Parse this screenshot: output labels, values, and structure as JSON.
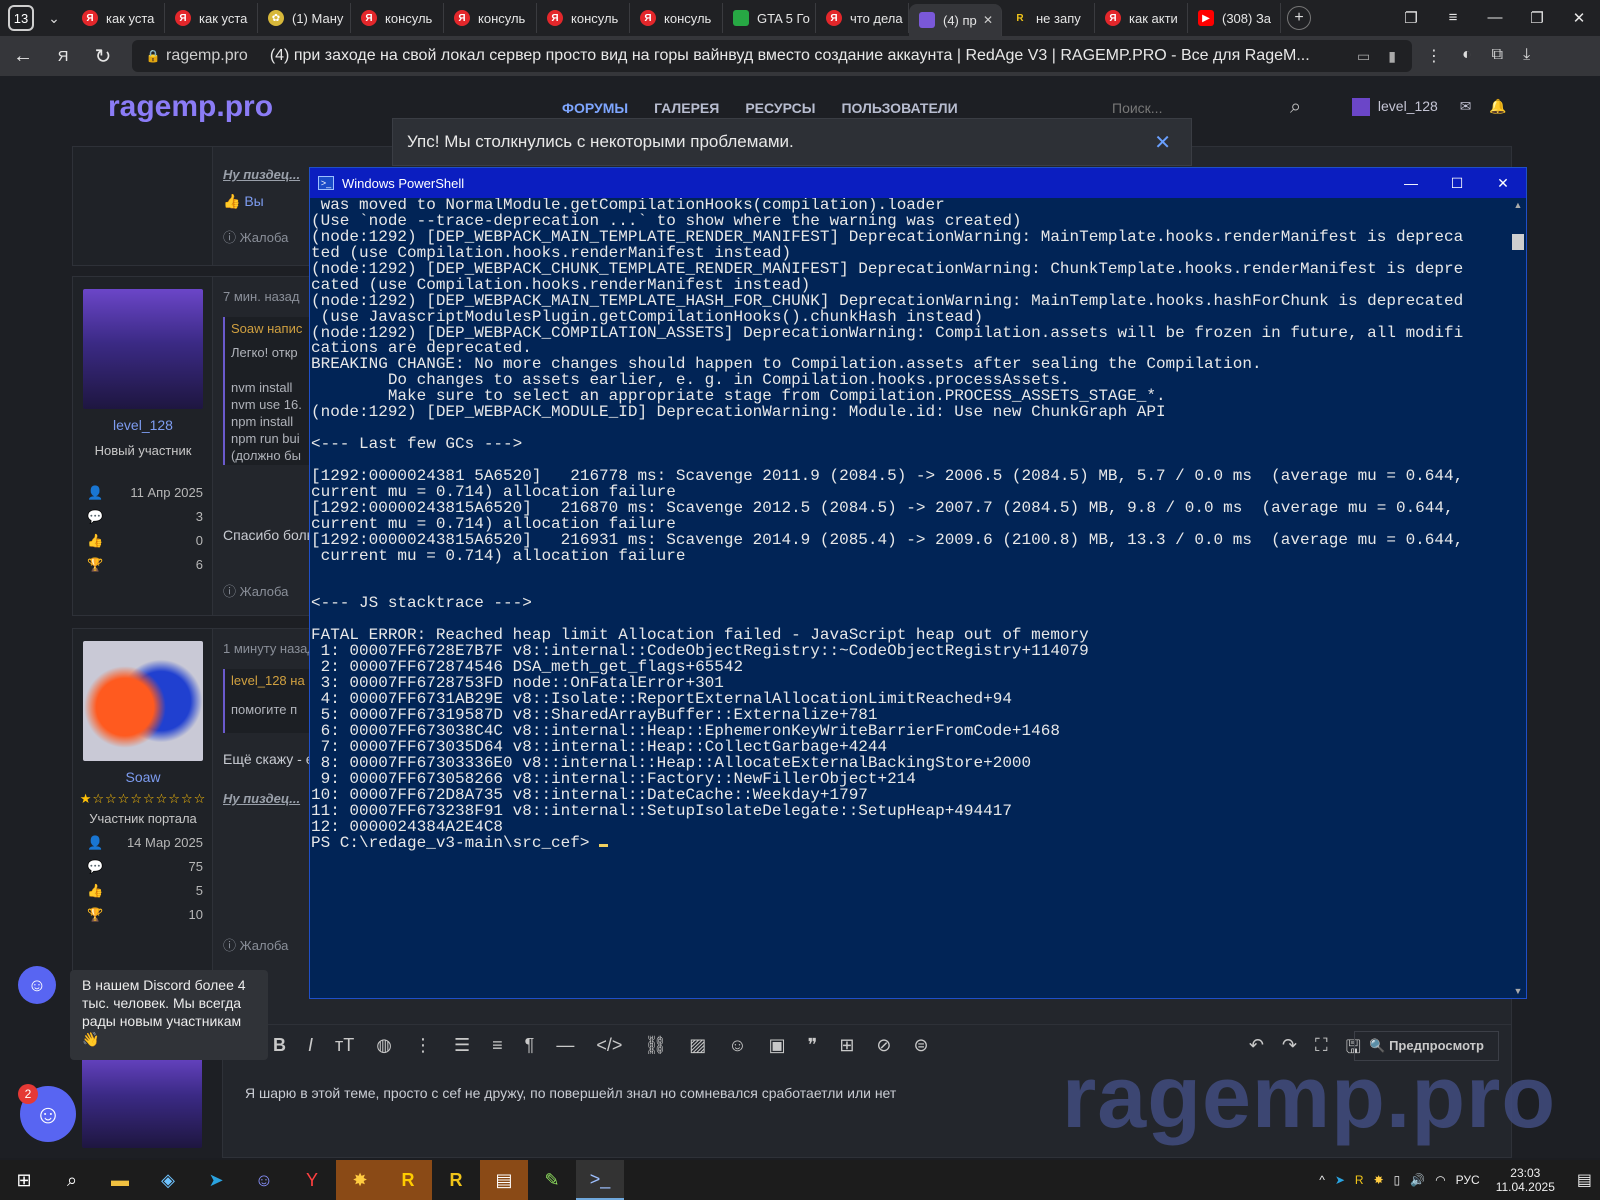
{
  "browser": {
    "tab_count": "13",
    "tabs": [
      {
        "label": "как уста",
        "icon": "ya"
      },
      {
        "label": "как уста",
        "icon": "ya"
      },
      {
        "label": "(1) Ману",
        "icon": "flower"
      },
      {
        "label": "консуль",
        "icon": "ya"
      },
      {
        "label": "консуль",
        "icon": "ya"
      },
      {
        "label": "консуль",
        "icon": "ya"
      },
      {
        "label": "консуль",
        "icon": "ya"
      },
      {
        "label": "GTA 5 Го",
        "icon": "green"
      },
      {
        "label": "что дела",
        "icon": "ya"
      },
      {
        "label": "(4) пр",
        "icon": "rage",
        "active": true
      },
      {
        "label": "не запу",
        "icon": "r"
      },
      {
        "label": "как акти",
        "icon": "ya"
      },
      {
        "label": "(308) За",
        "icon": "yt"
      }
    ],
    "address_domain": "ragemp.pro",
    "address_title": "(4) при заходе на свой локал сервер просто вид на горы вайнвуд вместо создание аккаунта | RedAge V3 | RAGEMP.PRO - Все для RageM..."
  },
  "site": {
    "logo": "ragemp.pro",
    "nav": [
      "ФОРУМЫ",
      "ГАЛЕРЕЯ",
      "РЕСУРСЫ",
      "ПОЛЬЗОВАТЕЛИ"
    ],
    "search_placeholder": "Поиск...",
    "user": "level_128",
    "error_banner": "Упс! Мы столкнулись с некоторыми проблемами.",
    "post0": {
      "sig": "Ну пиздец...",
      "you": "Вы",
      "report": "Жалоба"
    },
    "post1": {
      "time": "7 мин. назад",
      "username": "level_128",
      "role": "Новый участник",
      "joined": "11 Апр 2025",
      "messages": "3",
      "reactions": "0",
      "points": "6",
      "quote_author": "Soaw напис",
      "text_lines": [
        "Легко! откр",
        "nvm install",
        "nvm use 16.",
        "npm install",
        "npm run bui",
        "(должно бы"
      ],
      "reply": "Спасибо боль",
      "report": "Жалоба"
    },
    "post2": {
      "time": "1 минуту назад",
      "username": "Soaw",
      "role": "Участник портала",
      "joined": "14 Мар 2025",
      "messages": "75",
      "reactions": "5",
      "points": "10",
      "quote_author": "level_128 на",
      "quote_text": "помогите п",
      "reply": "Ещё скажу - е",
      "sig": "Ну пиздец...",
      "report": "Жалоба"
    },
    "editor_text": "Я шарю в этой теме, просто с cef не дружу, по повершейл знал но сомневался сработаетли или нет",
    "preview_label": "Предпросмотр",
    "watermark": "ragemp.pro",
    "discord_popup": "В нашем Discord более 4 тыс. человек. Мы всегда рады новым участникам 👋",
    "discord_badge": "2"
  },
  "powershell": {
    "title": "Windows PowerShell",
    "lines": [
      " was moved to NormalModule.getCompilationHooks(compilation).loader",
      "(Use `node --trace-deprecation ...` to show where the warning was created)",
      "(node:1292) [DEP_WEBPACK_MAIN_TEMPLATE_RENDER_MANIFEST] DeprecationWarning: MainTemplate.hooks.renderManifest is depreca",
      "ted (use Compilation.hooks.renderManifest instead)",
      "(node:1292) [DEP_WEBPACK_CHUNK_TEMPLATE_RENDER_MANIFEST] DeprecationWarning: ChunkTemplate.hooks.renderManifest is depre",
      "cated (use Compilation.hooks.renderManifest instead)",
      "(node:1292) [DEP_WEBPACK_MAIN_TEMPLATE_HASH_FOR_CHUNK] DeprecationWarning: MainTemplate.hooks.hashForChunk is deprecated",
      " (use JavascriptModulesPlugin.getCompilationHooks().chunkHash instead)",
      "(node:1292) [DEP_WEBPACK_COMPILATION_ASSETS] DeprecationWarning: Compilation.assets will be frozen in future, all modifi",
      "cations are deprecated.",
      "BREAKING CHANGE: No more changes should happen to Compilation.assets after sealing the Compilation.",
      "        Do changes to assets earlier, e. g. in Compilation.hooks.processAssets.",
      "        Make sure to select an appropriate stage from Compilation.PROCESS_ASSETS_STAGE_*.",
      "(node:1292) [DEP_WEBPACK_MODULE_ID] DeprecationWarning: Module.id: Use new ChunkGraph API",
      "",
      "<--- Last few GCs --->",
      "",
      "[1292:0000024381 5A6520]   216778 ms: Scavenge 2011.9 (2084.5) -> 2006.5 (2084.5) MB, 5.7 / 0.0 ms  (average mu = 0.644,",
      "current mu = 0.714) allocation failure",
      "[1292:00000243815A6520]   216870 ms: Scavenge 2012.5 (2084.5) -> 2007.7 (2084.5) MB, 9.8 / 0.0 ms  (average mu = 0.644,",
      "current mu = 0.714) allocation failure",
      "[1292:00000243815A6520]   216931 ms: Scavenge 2014.9 (2085.4) -> 2009.6 (2100.8) MB, 13.3 / 0.0 ms  (average mu = 0.644,",
      " current mu = 0.714) allocation failure",
      "",
      "",
      "<--- JS stacktrace --->",
      "",
      "FATAL ERROR: Reached heap limit Allocation failed - JavaScript heap out of memory",
      " 1: 00007FF6728E7B7F v8::internal::CodeObjectRegistry::~CodeObjectRegistry+114079",
      " 2: 00007FF672874546 DSA_meth_get_flags+65542",
      " 3: 00007FF6728753FD node::OnFatalError+301",
      " 4: 00007FF6731AB29E v8::Isolate::ReportExternalAllocationLimitReached+94",
      " 5: 00007FF67319587D v8::SharedArrayBuffer::Externalize+781",
      " 6: 00007FF673038C4C v8::internal::Heap::EphemeronKeyWriteBarrierFromCode+1468",
      " 7: 00007FF673035D64 v8::internal::Heap::CollectGarbage+4244",
      " 8: 00007FF67303336E0 v8::internal::Heap::AllocateExternalBackingStore+2000",
      " 9: 00007FF673058266 v8::internal::Factory::NewFillerObject+214",
      "10: 00007FF672D8A735 v8::internal::DateCache::Weekday+1797",
      "11: 00007FF673238F91 v8::internal::SetupIsolateDelegate::SetupHeap+494417",
      "12: 0000024384A2E4C8"
    ],
    "prompt": "PS C:\\redage_v3-main\\src_cef> "
  },
  "taskbar": {
    "lang": "РУС",
    "time": "23:03",
    "date": "11.04.2025"
  }
}
